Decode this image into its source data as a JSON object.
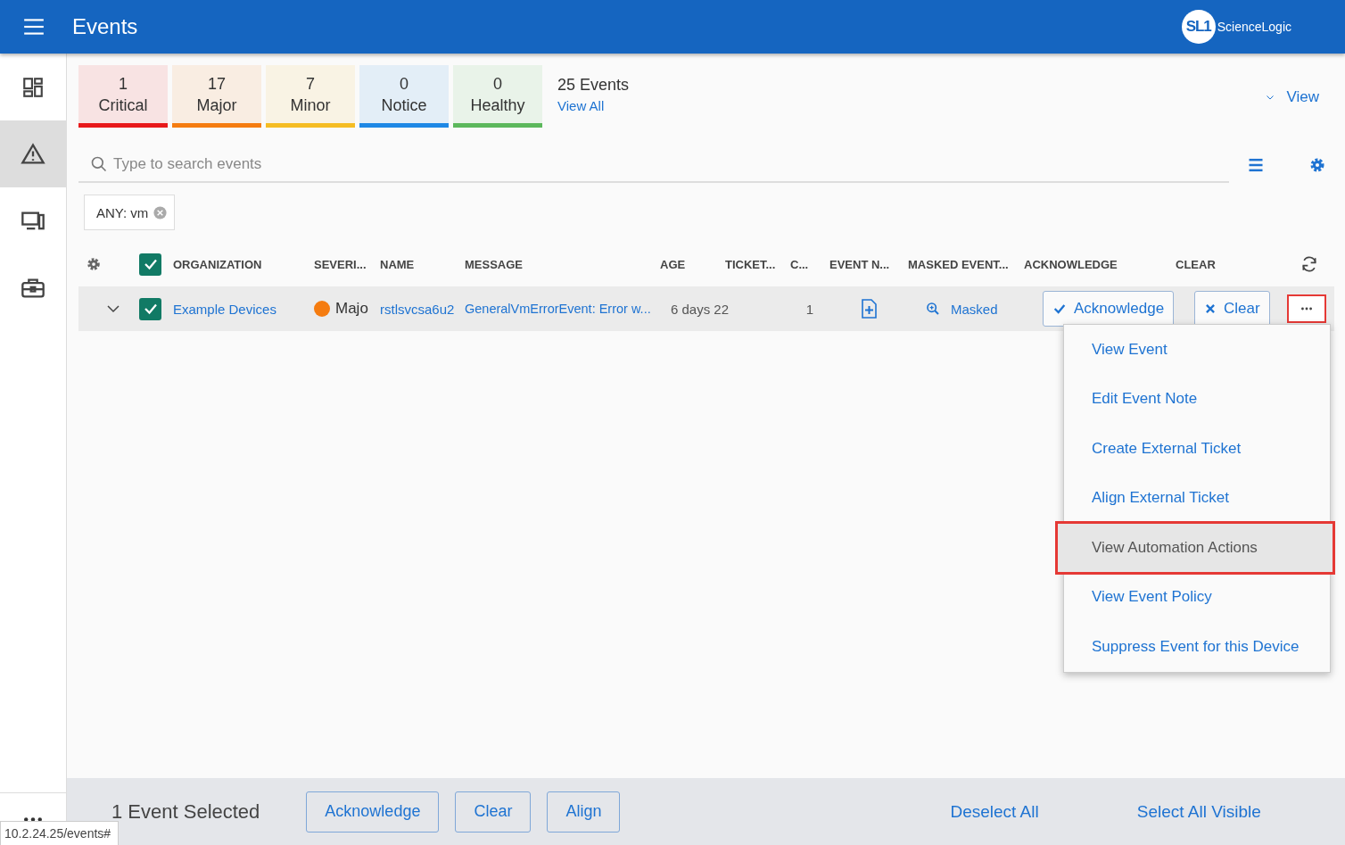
{
  "header": {
    "title": "Events",
    "logo_mark": "SL1",
    "logo_text": "ScienceLogic"
  },
  "sidebar": {
    "items": [
      {
        "kind": "dashboard",
        "selected": false
      },
      {
        "kind": "events",
        "selected": true
      },
      {
        "kind": "devices",
        "selected": false
      },
      {
        "kind": "toolbox",
        "selected": false
      }
    ]
  },
  "severity_tiles": [
    {
      "count": "1",
      "label": "Critical",
      "color": "#e8191b"
    },
    {
      "count": "17",
      "label": "Major",
      "color": "#f57c10"
    },
    {
      "count": "7",
      "label": "Minor",
      "color": "#f5bd23"
    },
    {
      "count": "0",
      "label": "Notice",
      "color": "#1e88e5"
    },
    {
      "count": "0",
      "label": "Healthy",
      "color": "#5cb85c"
    }
  ],
  "summary": {
    "total": "25 Events",
    "view_all": "View All"
  },
  "view_menu": "View",
  "search": {
    "placeholder": "Type to search events"
  },
  "filter_chips": [
    "ANY: vm"
  ],
  "table": {
    "select_all_checked": true,
    "columns": [
      "ORGANIZATION",
      "SEVERI...",
      "NAME",
      "MESSAGE",
      "AGE",
      "TICKET...",
      "C...",
      "EVENT N...",
      "MASKED EVENT...",
      "ACKNOWLEDGE",
      "CLEAR"
    ],
    "rows": [
      {
        "expanded": false,
        "checked": true,
        "organization": "Example Devices",
        "severity": "Majo",
        "color": "#f57c10",
        "name": "rstlsvcsa6u2",
        "message": "GeneralVmErrorEvent: Error w...",
        "age": "6 days 22",
        "count": "1",
        "masked": "Masked",
        "acknowledge": "Acknowledge",
        "clear": "Clear",
        "more_highlighted": true
      }
    ]
  },
  "row_menu": {
    "items": [
      {
        "label": "View Event",
        "selected": false
      },
      {
        "label": "Edit Event Note",
        "selected": false
      },
      {
        "label": "Create External Ticket",
        "selected": false
      },
      {
        "label": "Align External Ticket",
        "selected": false
      },
      {
        "label": "View Automation Actions",
        "selected": true
      },
      {
        "label": "View Event Policy",
        "selected": false
      },
      {
        "label": "Suppress Event for this Device",
        "selected": false
      }
    ]
  },
  "footer": {
    "selected_text": "1 Event Selected",
    "buttons": [
      "Acknowledge",
      "Clear",
      "Align"
    ],
    "deselect_all": "Deselect All",
    "select_all_visible": "Select All Visible"
  },
  "url_tooltip": "10.2.24.25/events#"
}
